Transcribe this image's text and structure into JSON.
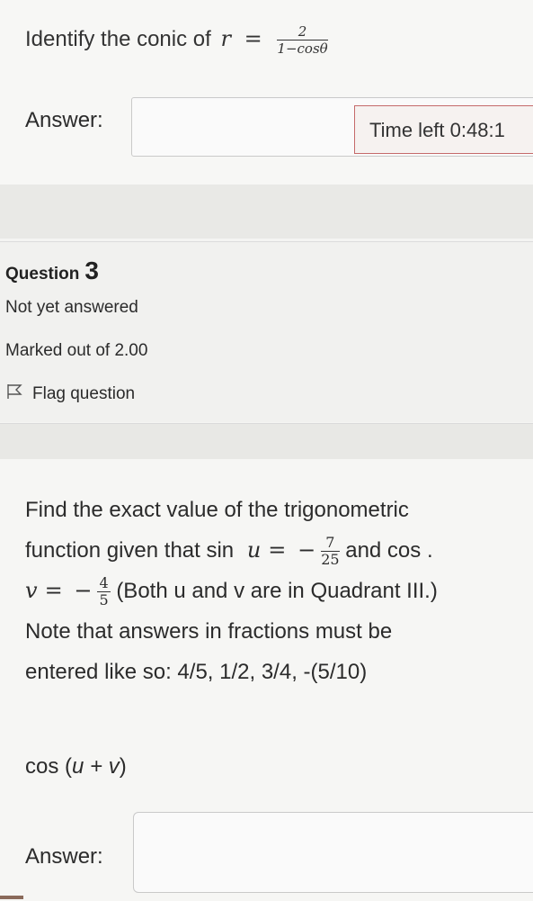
{
  "previous_question": {
    "prompt": "Identify the conic of",
    "variable": "r",
    "equals": "=",
    "numerator": "2",
    "denominator": "1−cosθ",
    "answer_label": "Answer:",
    "answer_value": ""
  },
  "timer": {
    "label": "Time left",
    "value": "0:48:1"
  },
  "question_info": {
    "label": "Question",
    "number": "3",
    "status": "Not yet answered",
    "marks": "Marked out of 2.00",
    "flag_label": "Flag question"
  },
  "question": {
    "line1": "Find the exact value of the trigonometric",
    "line2_prefix": "function given that sin",
    "var_u": "u",
    "eq": "=",
    "neg": "−",
    "u_num": "7",
    "u_den": "25",
    "line2_suffix": "and cos .",
    "var_v": "v",
    "v_num": "4",
    "v_den": "5",
    "line3_suffix": "(Both u and v are in Quadrant III.)",
    "line4": "Note that answers in fractions must be",
    "line5": "entered like so: 4/5, 1/2, 3/4, -(5/10)",
    "expression_fn": "cos (",
    "expression_arg": "u + v",
    "expression_close": ")",
    "answer_label": "Answer:",
    "answer_value": ""
  }
}
